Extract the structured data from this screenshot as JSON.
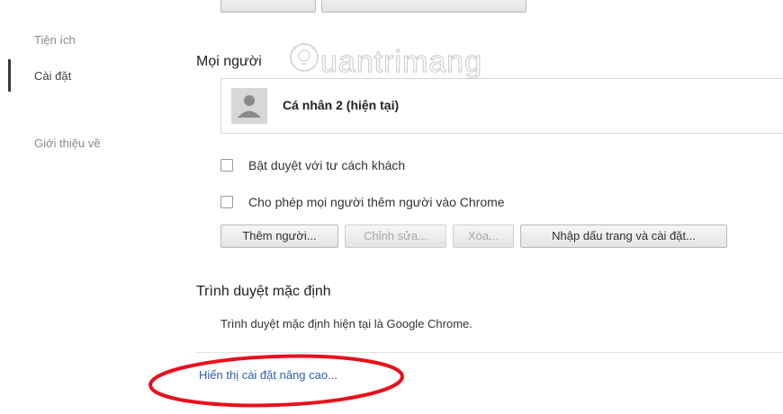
{
  "sidebar": {
    "items": [
      {
        "label": "Tiện ích"
      },
      {
        "label": "Cài đặt"
      },
      {
        "label": "Giới thiệu về"
      }
    ]
  },
  "people": {
    "title": "Mọi người",
    "profile": {
      "name": "Cá nhân 2 (hiện tại)",
      "avatar_icon": "person-icon"
    },
    "checkboxes": [
      {
        "label": "Bật duyệt với tư cách khách",
        "checked": false
      },
      {
        "label": "Cho phép mọi người thêm người vào Chrome",
        "checked": false
      }
    ],
    "buttons": [
      {
        "label": "Thêm người...",
        "disabled": false
      },
      {
        "label": "Chỉnh sửa...",
        "disabled": true
      },
      {
        "label": "Xóa...",
        "disabled": true
      },
      {
        "label": "Nhập dấu trang và cài đặt...",
        "disabled": false
      }
    ]
  },
  "default_browser": {
    "title": "Trình duyệt mặc định",
    "text": "Trình duyệt mặc định hiện tại là Google Chrome."
  },
  "advanced_link": "Hiển thị cài đặt nâng cao...",
  "watermark": {
    "text": "uantrimang"
  },
  "colors": {
    "link": "#2a5db0",
    "highlight_ellipse": "#e8101a",
    "active_indicator": "#3a3a3a"
  }
}
